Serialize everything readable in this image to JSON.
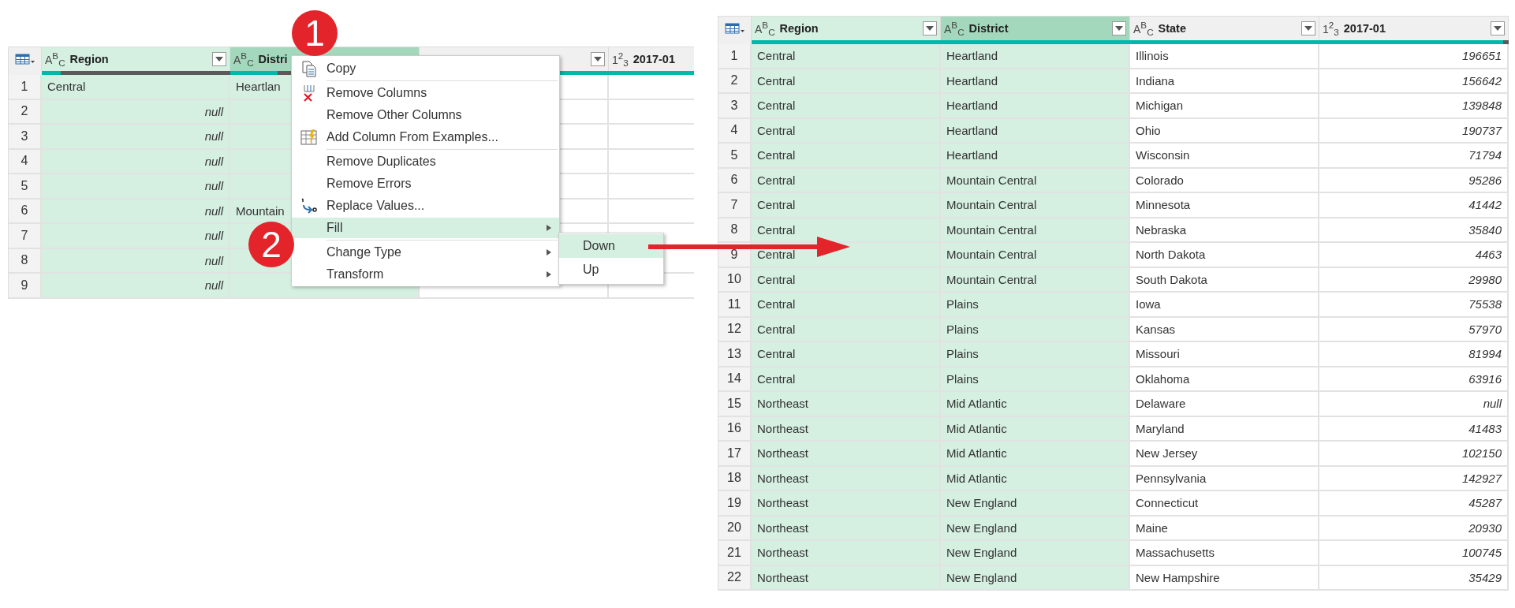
{
  "left_table": {
    "columns": [
      {
        "type_label": "A$^{B}$$_{C}$",
        "name": "Region",
        "selected": true,
        "active": false,
        "dropdown": true,
        "level": 0.1
      },
      {
        "type_label": "A$^{B}$$_{C}$",
        "name": "Distri",
        "selected": true,
        "active": true,
        "dropdown": false,
        "level": 0.25
      },
      {
        "selected": false,
        "active": false,
        "dropdown": true,
        "level": 1
      },
      {
        "type_label": "1$^{2}$$_{3}$",
        "name": "2017-01",
        "selected": false,
        "active": false,
        "dropdown": false,
        "level": 1
      }
    ],
    "rows": [
      {
        "number": "1",
        "cells": [
          {
            "text": "Central",
            "kind": "text"
          },
          {
            "text": "Heartlan",
            "kind": "text"
          }
        ]
      },
      {
        "number": "2",
        "cells": [
          {
            "text": "null",
            "kind": "null"
          }
        ]
      },
      {
        "number": "3",
        "cells": [
          {
            "text": "null",
            "kind": "null"
          }
        ]
      },
      {
        "number": "4",
        "cells": [
          {
            "text": "null",
            "kind": "null"
          }
        ]
      },
      {
        "number": "5",
        "cells": [
          {
            "text": "null",
            "kind": "null"
          }
        ]
      },
      {
        "number": "6",
        "cells": [
          {
            "text": "null",
            "kind": "null"
          },
          {
            "text": "Mountain",
            "kind": "text"
          }
        ]
      },
      {
        "number": "7",
        "cells": [
          {
            "text": "null",
            "kind": "null"
          }
        ]
      },
      {
        "number": "8",
        "cells": [
          {
            "text": "null",
            "kind": "null"
          }
        ]
      },
      {
        "number": "9",
        "cells": [
          {
            "text": "null",
            "kind": "null"
          }
        ]
      }
    ]
  },
  "context_menu": {
    "items": [
      {
        "kind": "copy",
        "label": "Copy",
        "has_submenu": false,
        "selected": false
      },
      {
        "kind": "separator"
      },
      {
        "kind": "remove",
        "label": "Remove Columns",
        "has_submenu": false,
        "selected": false
      },
      {
        "kind": "plain",
        "label": "Remove Other Columns",
        "has_submenu": false,
        "selected": false
      },
      {
        "kind": "examples",
        "label": "Add Column From Examples...",
        "has_submenu": false,
        "selected": false
      },
      {
        "kind": "separator"
      },
      {
        "kind": "plain",
        "label": "Remove Duplicates",
        "has_submenu": false,
        "selected": false
      },
      {
        "kind": "plain",
        "label": "Remove Errors",
        "has_submenu": false,
        "selected": false
      },
      {
        "kind": "replace",
        "label": "Replace Values...",
        "has_submenu": false,
        "selected": false
      },
      {
        "kind": "plain",
        "label": "Fill",
        "has_submenu": true,
        "selected": true
      },
      {
        "kind": "separator"
      },
      {
        "kind": "plain",
        "label": "Change Type",
        "has_submenu": true,
        "selected": false
      },
      {
        "kind": "plain",
        "label": "Transform",
        "has_submenu": true,
        "selected": false
      }
    ],
    "submenu": [
      {
        "label": "Down",
        "selected": true
      },
      {
        "label": "Up",
        "selected": false
      }
    ]
  },
  "annotations": [
    {
      "label": "1"
    },
    {
      "label": "2"
    }
  ],
  "right_table": {
    "columns": [
      {
        "type_label": "A$^{B}$$_{C}$",
        "name": "Region",
        "kind": "text",
        "selected": true,
        "active": false,
        "level": 1
      },
      {
        "type_label": "A$^{B}$$_{C}$",
        "name": "District",
        "kind": "text",
        "selected": true,
        "active": true,
        "level": 1
      },
      {
        "type_label": "A$^{B}$$_{C}$",
        "name": "State",
        "kind": "text",
        "selected": false,
        "active": false,
        "level": 1
      },
      {
        "type_label": "1$^{2}$$_{3}$",
        "name": "2017-01",
        "kind": "number",
        "selected": false,
        "active": false,
        "level": 0.97
      }
    ],
    "rows": [
      {
        "number": "1",
        "cells": [
          "Central",
          "Heartland",
          "Illinois",
          "196651"
        ]
      },
      {
        "number": "2",
        "cells": [
          "Central",
          "Heartland",
          "Indiana",
          "156642"
        ]
      },
      {
        "number": "3",
        "cells": [
          "Central",
          "Heartland",
          "Michigan",
          "139848"
        ]
      },
      {
        "number": "4",
        "cells": [
          "Central",
          "Heartland",
          "Ohio",
          "190737"
        ]
      },
      {
        "number": "5",
        "cells": [
          "Central",
          "Heartland",
          "Wisconsin",
          "71794"
        ]
      },
      {
        "number": "6",
        "cells": [
          "Central",
          "Mountain Central",
          "Colorado",
          "95286"
        ]
      },
      {
        "number": "7",
        "cells": [
          "Central",
          "Mountain Central",
          "Minnesota",
          "41442"
        ]
      },
      {
        "number": "8",
        "cells": [
          "Central",
          "Mountain Central",
          "Nebraska",
          "35840"
        ]
      },
      {
        "number": "9",
        "cells": [
          "Central",
          "Mountain Central",
          "North Dakota",
          "4463"
        ]
      },
      {
        "number": "10",
        "cells": [
          "Central",
          "Mountain Central",
          "South Dakota",
          "29980"
        ]
      },
      {
        "number": "11",
        "cells": [
          "Central",
          "Plains",
          "Iowa",
          "75538"
        ]
      },
      {
        "number": "12",
        "cells": [
          "Central",
          "Plains",
          "Kansas",
          "57970"
        ]
      },
      {
        "number": "13",
        "cells": [
          "Central",
          "Plains",
          "Missouri",
          "81994"
        ]
      },
      {
        "number": "14",
        "cells": [
          "Central",
          "Plains",
          "Oklahoma",
          "63916"
        ]
      },
      {
        "number": "15",
        "cells": [
          "Northeast",
          "Mid Atlantic",
          "Delaware",
          "null"
        ]
      },
      {
        "number": "16",
        "cells": [
          "Northeast",
          "Mid Atlantic",
          "Maryland",
          "41483"
        ]
      },
      {
        "number": "17",
        "cells": [
          "Northeast",
          "Mid Atlantic",
          "New Jersey",
          "102150"
        ]
      },
      {
        "number": "18",
        "cells": [
          "Northeast",
          "Mid Atlantic",
          "Pennsylvania",
          "142927"
        ]
      },
      {
        "number": "19",
        "cells": [
          "Northeast",
          "New England",
          "Connecticut",
          "45287"
        ]
      },
      {
        "number": "20",
        "cells": [
          "Northeast",
          "New England",
          "Maine",
          "20930"
        ]
      },
      {
        "number": "21",
        "cells": [
          "Northeast",
          "New England",
          "Massachusetts",
          "100745"
        ]
      },
      {
        "number": "22",
        "cells": [
          "Northeast",
          "New England",
          "New Hampshire",
          "35429"
        ]
      }
    ]
  }
}
